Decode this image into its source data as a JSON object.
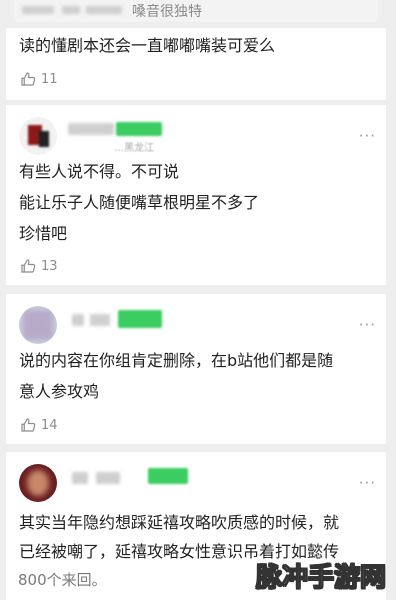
{
  "quote": {
    "text": "嗓音很独特"
  },
  "comments": [
    {
      "lines": [
        "读的懂剧本还会一直嘟嘟嘴装可爱么"
      ],
      "likes": "11"
    },
    {
      "location": "…黑龙江",
      "lines": [
        "有些人说不得。不可说",
        "能让乐子人随便嘴草根明星不多了",
        "珍惜吧"
      ],
      "likes": "13"
    },
    {
      "lines": [
        "说的内容在你组肯定删除，在b站他们都是随",
        "意人参攻鸡"
      ],
      "likes": "14"
    },
    {
      "lines": [
        "其实当年隐约想踩延禧攻略吹质感的时候，就",
        "已经被嘲了，延禧攻略女性意识吊着打如懿传"
      ]
    }
  ],
  "more_label": "···",
  "footer": "800个来回。",
  "watermark": "脉冲手游网"
}
